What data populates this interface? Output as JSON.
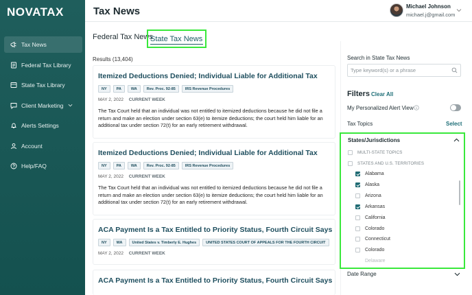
{
  "app": {
    "logo": "NOVATAX"
  },
  "sidebar": {
    "items": [
      {
        "label": "Tax News",
        "icon": "megaphone-icon",
        "active": true
      },
      {
        "label": "Federal Tax Library",
        "icon": "document-icon"
      },
      {
        "label": "State Tax Library",
        "icon": "folder-icon"
      },
      {
        "label": "Client Marketing",
        "icon": "chat-icon",
        "has_submenu": true
      },
      {
        "label": "Alerts Settings",
        "icon": "bell-icon"
      },
      {
        "label": "Account",
        "icon": "user-icon"
      },
      {
        "label": "Help/FAQ",
        "icon": "help-icon"
      }
    ]
  },
  "header": {
    "title": "Tax News",
    "user": {
      "name": "Michael Johnson",
      "email": "michael.j@gmail.com"
    }
  },
  "tabs": [
    {
      "label": "Federal Tax News",
      "active": false
    },
    {
      "label": "State Tax News",
      "active": true
    }
  ],
  "results": {
    "count_label": "Results (13,404)",
    "items": [
      {
        "title": "Itemized Deductions Denied; Individual Liable for Additional Tax",
        "tags": [
          "NY",
          "PA",
          "WA",
          "Rev. Proc. 92-85",
          "IRS Revenue Procedures"
        ],
        "date": "MAY 2, 2022",
        "week": "CURRENT WEEK",
        "summary": "The Tax Court held that an individual was not entitled to itemized deductions because he did not file a return and make an election under section 63(e) to itemize deductions; the court held him liable for an additional tax under section 72(t) for an early retirement withdrawal."
      },
      {
        "title": "Itemized Deductions Denied; Individual Liable for Additional Tax",
        "tags": [
          "NY",
          "PA",
          "WA",
          "Rev. Proc. 92-85",
          "IRS Revenue Procedures"
        ],
        "date": "MAY 2, 2022",
        "week": "CURRENT WEEK",
        "summary": "The Tax Court held that an individual was not entitled to itemized deductions because he did not file a return and make an election under section 63(e) to itemize deductions; the court held him liable for an additional tax under section 72(t) for an early retirement withdrawal."
      },
      {
        "title": "ACA Payment Is a Tax Entitled to Priority Status, Fourth Circuit Says",
        "tags": [
          "NY",
          "WA",
          "United States v. Timberly E. Hughes",
          "UNITED STATES COURT OF APPEALS FOR THE FOURTH CIRCUIT"
        ],
        "date": "MAY 2, 2022",
        "week": "CURRENT WEEK",
        "summary": ""
      },
      {
        "title": "ACA Payment Is a Tax Entitled to Priority Status, Fourth Circuit Says",
        "tags": [],
        "date": "",
        "week": "",
        "summary": ""
      }
    ]
  },
  "search": {
    "label": "Search in State Tax News",
    "placeholder": "Type keyword(s) or a phrase",
    "value": ""
  },
  "filters": {
    "title": "Filters",
    "clear_all": "Clear All",
    "alert_view_label": "My Personalized Alert View",
    "alert_view_on": false,
    "tax_topics_label": "Tax Topics",
    "select_label": "Select",
    "states": {
      "title": "States/Jurisdictions",
      "options": [
        {
          "label": "MULTI-STATE TOPICS",
          "group": true,
          "checked": false
        },
        {
          "label": "STATES AND U.S. TERRITORIES",
          "group": true,
          "checked": false
        },
        {
          "label": "Alabama",
          "checked": true
        },
        {
          "label": "Alaska",
          "checked": true
        },
        {
          "label": "Arizona",
          "checked": false
        },
        {
          "label": "Arkansas",
          "checked": true
        },
        {
          "label": "California",
          "checked": false
        },
        {
          "label": "Colorado",
          "checked": false
        },
        {
          "label": "Connecticut",
          "checked": false
        },
        {
          "label": "Colorado",
          "checked": false
        },
        {
          "label": "Delaware",
          "checked": false
        }
      ]
    },
    "date_range_label": "Date Range"
  },
  "colors": {
    "sidebar": "#1f5e5c",
    "accent": "#1e6e77",
    "highlight": "#38e83a"
  }
}
